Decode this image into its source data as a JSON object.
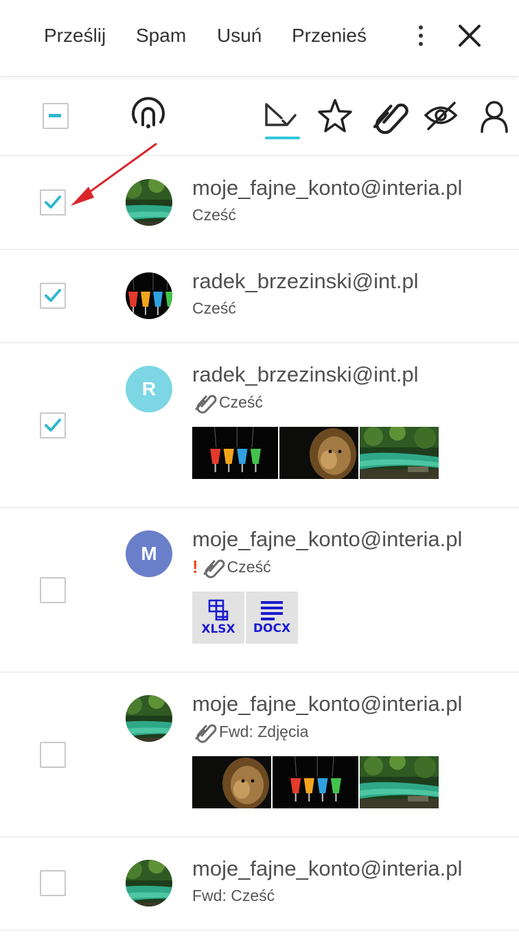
{
  "toolbar": {
    "forward": "Prześlij",
    "spam": "Spam",
    "delete": "Usuń",
    "move": "Przenieś"
  },
  "filters": {
    "active": "unread",
    "items": [
      "unread-filter",
      "favorite-filter",
      "attachment-filter",
      "unseen-filter",
      "contacts-filter"
    ]
  },
  "colors": {
    "accent": "#35c6dc",
    "avatar_r": "#7dd6e3",
    "avatar_m": "#6a7fc9",
    "priority": "#e8501d",
    "file_ext": "#1a1ad0",
    "annotation_arrow": "#d9262b"
  },
  "messages": [
    {
      "sender": "moje_fajne_konto@interia.pl",
      "subject": "Cześć",
      "checked": true,
      "avatar": "landscape-photo",
      "attachment_icon": false,
      "priority": false
    },
    {
      "sender": "radek_brzezinski@int.pl",
      "subject": "Cześć",
      "checked": true,
      "avatar": "glasses-photo",
      "attachment_icon": false,
      "priority": false
    },
    {
      "sender": "radek_brzezinski@int.pl",
      "subject": "Cześć",
      "checked": true,
      "avatar_letter": "R",
      "attachment_icon": true,
      "priority": false,
      "attachments": [
        "glasses-image",
        "lion-image",
        "river-image"
      ]
    },
    {
      "sender": "moje_fajne_konto@interia.pl",
      "subject": "Cześć",
      "checked": false,
      "avatar_letter": "M",
      "attachment_icon": true,
      "priority": true,
      "priority_mark": "!",
      "files": [
        {
          "ext": "XLSX",
          "icon": "spreadsheet-icon"
        },
        {
          "ext": "DOCX",
          "icon": "document-icon"
        }
      ]
    },
    {
      "sender": "moje_fajne_konto@interia.pl",
      "subject": "Fwd: Zdjęcia",
      "checked": false,
      "avatar": "landscape-photo",
      "attachment_icon": true,
      "priority": false,
      "attachments": [
        "lion-image",
        "glasses-image",
        "river-image"
      ]
    },
    {
      "sender": "moje_fajne_konto@interia.pl",
      "subject": "Fwd: Cześć",
      "checked": false,
      "avatar": "landscape-photo",
      "attachment_icon": false,
      "priority": false
    }
  ]
}
